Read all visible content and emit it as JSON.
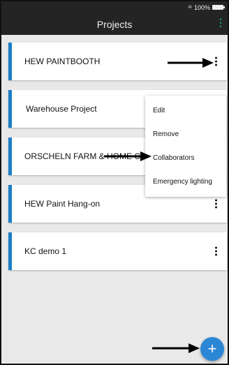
{
  "status_bar": {
    "battery": "100%"
  },
  "header": {
    "title": "Projects"
  },
  "projects": [
    {
      "name": "HEW PAINTBOOTH"
    },
    {
      "name": "Warehouse Project"
    },
    {
      "name": "ORSCHELN FARM & HOME CO."
    },
    {
      "name": "HEW Paint Hang-on"
    },
    {
      "name": "KC demo 1"
    }
  ],
  "context_menu": {
    "items": [
      "Edit",
      "Remove",
      "Collaborators",
      "Emergency lighting"
    ]
  },
  "fab": {
    "label": "+"
  },
  "colors": {
    "accent": "#1c7ec6",
    "header_bg": "#242424",
    "menu_icon": "#18b06b",
    "fab": "#2c86d6"
  }
}
